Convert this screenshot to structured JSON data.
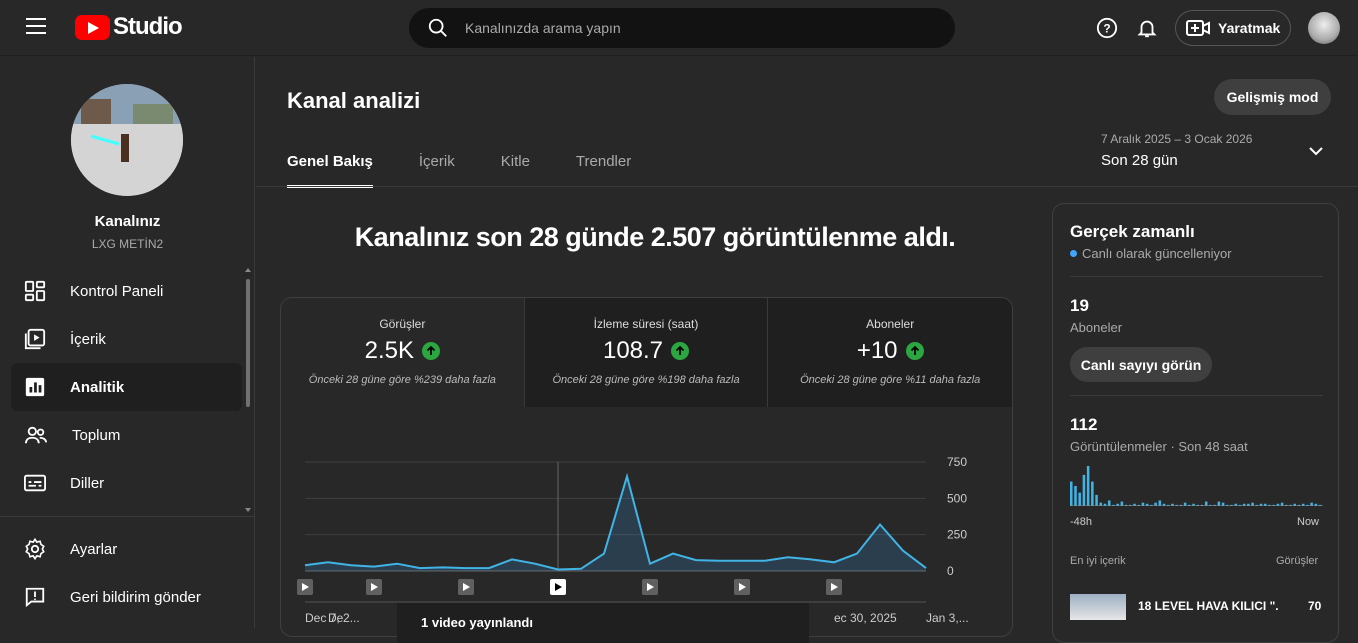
{
  "header": {
    "logo_text": "Studio",
    "search_placeholder": "Kanalınızda arama yapın",
    "create_label": "Yaratmak"
  },
  "sidebar": {
    "channel_title": "Kanalınız",
    "channel_name": "LXG METİN2",
    "items": [
      {
        "label": "Kontrol Paneli",
        "icon": "dashboard-icon"
      },
      {
        "label": "İçerik",
        "icon": "content-icon"
      },
      {
        "label": "Analitik",
        "icon": "analytics-icon"
      },
      {
        "label": "Toplum",
        "icon": "community-icon"
      },
      {
        "label": "Diller",
        "icon": "subtitles-icon"
      }
    ],
    "bottom_items": [
      {
        "label": "Ayarlar",
        "icon": "gear-icon"
      },
      {
        "label": "Geri bildirim gönder",
        "icon": "feedback-icon"
      }
    ]
  },
  "main": {
    "title": "Kanal analizi",
    "advanced_button": "Gelişmiş mod",
    "tabs": [
      "Genel Bakış",
      "İçerik",
      "Kitle",
      "Trendler"
    ],
    "date_range": "7 Aralık 2025 – 3 Ocak 2026",
    "date_label": "Son 28 gün",
    "headline": "Kanalınız son 28 günde 2.507 görüntülenme aldı.",
    "metrics": [
      {
        "label": "Görüşler",
        "value": "2.5K",
        "compare": "Önceki 28 güne göre %239 daha fazla"
      },
      {
        "label": "İzleme süresi (saat)",
        "value": "108.7",
        "compare": "Önceki 28 güne göre %198 daha fazla"
      },
      {
        "label": "Aboneler",
        "value": "+10",
        "compare": "Önceki 28 güne göre %11 daha fazla"
      }
    ],
    "tooltip": "1 video yayınlandı"
  },
  "realtime": {
    "title": "Gerçek zamanlı",
    "live_text": "Canlı olarak güncelleniyor",
    "subscribers_value": "19",
    "subscribers_label": "Aboneler",
    "live_button": "Canlı sayıyı görün",
    "views_value": "112",
    "views_label": "Görüntülenmeler · Son 48 saat",
    "axis_start": "-48h",
    "axis_end": "Now",
    "top_content_label": "En iyi içerik",
    "top_content_col": "Görüşler",
    "top_item_title": "18 LEVEL HAVA KILICI \"...",
    "top_item_views": "70"
  },
  "colors": {
    "accent": "#3ea6ff",
    "brand": "#ff0000",
    "up": "#2ba640"
  },
  "chart_data": [
    {
      "type": "line",
      "x": [
        "Dec 7, 2...",
        "De",
        "",
        "",
        "",
        "",
        "",
        "",
        "",
        "",
        "",
        "",
        "",
        "",
        "",
        "",
        "",
        "",
        "",
        "",
        "",
        "",
        "",
        "ec 30, 2025",
        "",
        "",
        "",
        "Jan 3,..."
      ],
      "values": [
        40,
        60,
        40,
        30,
        50,
        20,
        25,
        20,
        20,
        80,
        50,
        10,
        15,
        120,
        650,
        50,
        120,
        75,
        70,
        70,
        70,
        95,
        80,
        60,
        120,
        320,
        140,
        20
      ],
      "y_ticks": [
        "750",
        "500",
        "250",
        "0"
      ],
      "ylim": [
        0,
        750
      ],
      "video_markers": [
        0,
        3,
        7,
        11,
        15,
        19,
        23
      ],
      "selected_marker": 11
    },
    {
      "type": "bar",
      "values": [
        22,
        18,
        12,
        28,
        36,
        22,
        10,
        3,
        2,
        5,
        1,
        2,
        4,
        1,
        1,
        2,
        1,
        3,
        2,
        1,
        3,
        5,
        2,
        1,
        2,
        1,
        1,
        3,
        1,
        2,
        1,
        1,
        4,
        1,
        1,
        4,
        3,
        1,
        1,
        2,
        1,
        2,
        2,
        3,
        1,
        2,
        2,
        1,
        1,
        2,
        3,
        1,
        1,
        2,
        1,
        2,
        1,
        3,
        2,
        1
      ],
      "x": [
        "-48h",
        "Now"
      ]
    }
  ]
}
